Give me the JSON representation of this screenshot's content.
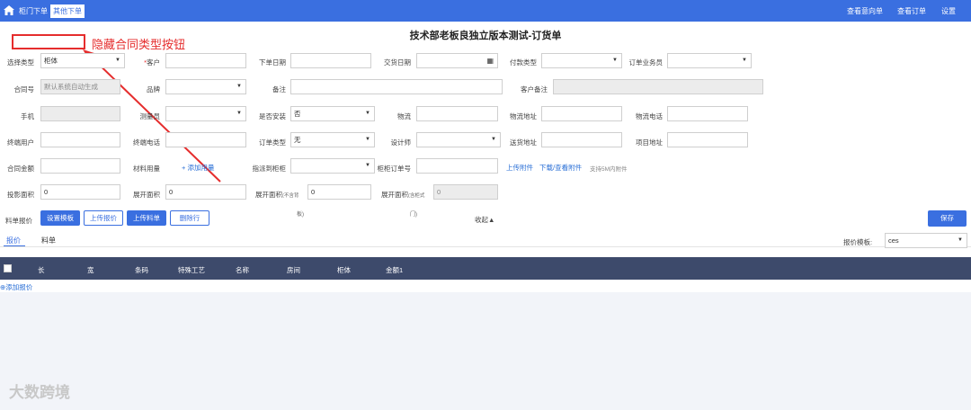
{
  "topbar": {
    "tabs": [
      {
        "label": "柜门下单"
      },
      {
        "label": "其他下单"
      }
    ],
    "links": [
      {
        "label": "查看意向单"
      },
      {
        "label": "查看订单"
      },
      {
        "label": "设置"
      }
    ]
  },
  "page_title": "技术部老板良独立版本测试-订货单",
  "annotation": "隐藏合同类型按钮",
  "form": {
    "select_type": {
      "label": "选择类型",
      "value": "柜体"
    },
    "customer": {
      "label": "客户",
      "value": ""
    },
    "order_date": {
      "label": "下单日期",
      "value": ""
    },
    "delivery_date": {
      "label": "交货日期",
      "value": ""
    },
    "payment_type": {
      "label": "付款类型",
      "value": ""
    },
    "salesman": {
      "label": "订单业务员",
      "value": ""
    },
    "contract_no": {
      "label": "合同号",
      "placeholder": "默认系统自动生成"
    },
    "brand": {
      "label": "品牌",
      "value": ""
    },
    "remark": {
      "label": "备注",
      "value": ""
    },
    "customer_remark": {
      "label": "客户备注",
      "value": ""
    },
    "phone": {
      "label": "手机",
      "value": ""
    },
    "measurer": {
      "label": "测量员",
      "value": ""
    },
    "install": {
      "label": "是否安装",
      "value": "否"
    },
    "logistics": {
      "label": "物流",
      "value": ""
    },
    "logistics_addr": {
      "label": "物流地址",
      "value": ""
    },
    "logistics_phone": {
      "label": "物流电话",
      "value": ""
    },
    "end_user": {
      "label": "终端用户",
      "value": ""
    },
    "end_phone": {
      "label": "终端电话",
      "value": ""
    },
    "order_type": {
      "label": "订单类型",
      "value": "无"
    },
    "designer": {
      "label": "设计师",
      "value": ""
    },
    "ship_addr": {
      "label": "送货地址",
      "value": ""
    },
    "project_addr": {
      "label": "项目地址",
      "value": ""
    },
    "contract_amount": {
      "label": "合同金额",
      "value": ""
    },
    "material_usage": {
      "label": "材料用量",
      "link": "+ 添加用量"
    },
    "assign_cabinet": {
      "label": "指派到柜柜",
      "value": ""
    },
    "cabinet_order_no": {
      "label": "柜柜订单号",
      "value": ""
    },
    "upload_attach": "上传附件",
    "download_attach": "下载/查看附件",
    "attach_hint": "支持5M内附件",
    "projection_area": {
      "label": "投影面积",
      "value": "0"
    },
    "expand_area": {
      "label": "展开面积",
      "value": "0"
    },
    "expand_area_nodoor": {
      "label": "展开面积",
      "sub": "(不含背",
      "sub2": "板)",
      "value": "0"
    },
    "expand_area_door": {
      "label": "展开面积",
      "sub": "(含柜式",
      "sub2": "门)",
      "value": "0"
    }
  },
  "actions": {
    "quote_label": "料单报价",
    "set_template": "设置模板",
    "upload_quote": "上传报价",
    "upload_bom": "上传料单",
    "delete_row": "删除行",
    "collapse": "收起▲",
    "save": "保存"
  },
  "tabs": [
    {
      "label": "报价"
    },
    {
      "label": "料单"
    }
  ],
  "quote_template": {
    "label": "报价模板:",
    "value": "ces"
  },
  "table": {
    "columns": [
      "长",
      "宽",
      "条码",
      "特殊工艺",
      "名称",
      "房间",
      "柜体",
      "金额1"
    ],
    "add_row": "添加报价"
  },
  "watermark": "大数跨境"
}
